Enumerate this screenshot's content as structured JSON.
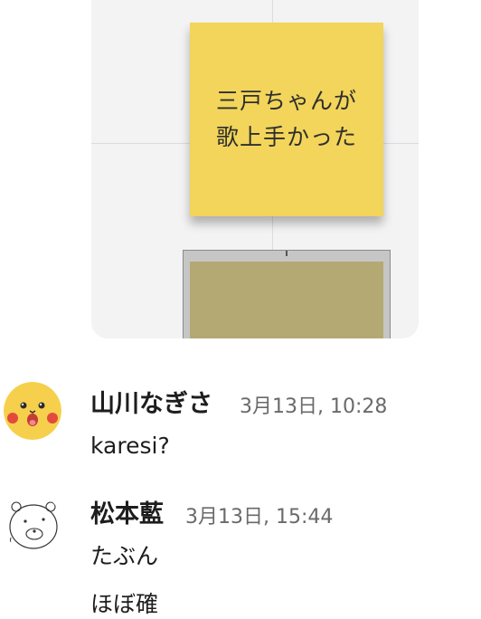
{
  "shared_image": {
    "sticky_note_lines": [
      "三戸ちゃんが",
      "歌上手かった"
    ]
  },
  "messages": [
    {
      "author": "山川なぎさ",
      "timestamp": "3月13日, 10:28",
      "lines": [
        "karesi?"
      ],
      "avatar": "pikachu-avatar"
    },
    {
      "author": "松本藍",
      "timestamp": "3月13日, 15:44",
      "lines": [
        "たぶん",
        "ほぼ確"
      ],
      "avatar": "bear-sketch-avatar"
    }
  ],
  "colors": {
    "sticky_note": "#f2d55a",
    "card_background": "#f3f3f4",
    "timestamp": "#6a6a6a"
  }
}
